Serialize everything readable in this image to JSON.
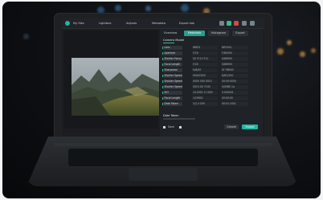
{
  "toolbar": {
    "menu_1": "My files",
    "menu_2": "Lightbox",
    "menu_3": "Adjusts",
    "menu_4": "Metadata",
    "menu_5": "Export tab"
  },
  "panel": {
    "tabs": [
      "Overview",
      "Metadata",
      "Histogram",
      "Export"
    ],
    "section_title": "Camera Model",
    "rows": [
      {
        "label": "Lens",
        "v1": "WR03",
        "v2": "DR2901"
      },
      {
        "label": "Aperture",
        "v1": "F/20",
        "v2": "F/80000"
      },
      {
        "label": "Shutter Focus",
        "v1": "00 F110 F11",
        "v2": "S/68900"
      },
      {
        "label": "Focal Length",
        "v1": "F/20",
        "v2": "S/68900"
      },
      {
        "label": "Sharpness",
        "v1": "H/8/00",
        "v2": "0F 98000"
      },
      {
        "label": "Shutter Speed",
        "v1": "00002003",
        "v2": "D/81/200"
      },
      {
        "label": "Shutter Speed",
        "v1": "0000 000 0013",
        "v2": "00:00:0000"
      },
      {
        "label": "Shutter Speed",
        "v1": "0010.00 7100",
        "v2": "0/00B0 1a"
      },
      {
        "label": "ISO",
        "v1": "10.0001 0 1000",
        "v2": "0.000001"
      },
      {
        "label": "Focal Length",
        "v1": "1/29601",
        "v2": "00:00:00"
      },
      {
        "label": "Date Taken",
        "v1": "1/2,4 009",
        "v2": "00:01:1001"
      }
    ],
    "footer_title": "Date Taken",
    "footer_check": "Save",
    "cancel": "Cancel",
    "apply": "Export"
  },
  "colors": {
    "accent": "#1fb6a6",
    "highlight": "#2fbf8f"
  }
}
